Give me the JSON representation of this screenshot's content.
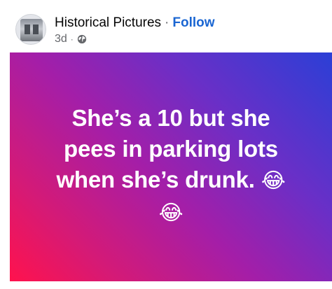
{
  "header": {
    "page_name": "Historical Pictures",
    "separator": "·",
    "follow_label": "Follow",
    "timestamp": "3d",
    "meta_separator": "·",
    "audience_icon": "globe-icon"
  },
  "post": {
    "line1": "She’s a 10 but she",
    "line2": "pees in parking lots",
    "line3": "when she’s drunk.",
    "emoji1": "😂",
    "emoji2": "😂",
    "background_gradient": [
      "#2b3fd6",
      "#6a2fc7",
      "#a41ea8",
      "#d41a77",
      "#ff124d"
    ]
  },
  "colors": {
    "follow": "#1b66d2",
    "meta_text": "#65676b",
    "title_text": "#050505"
  }
}
